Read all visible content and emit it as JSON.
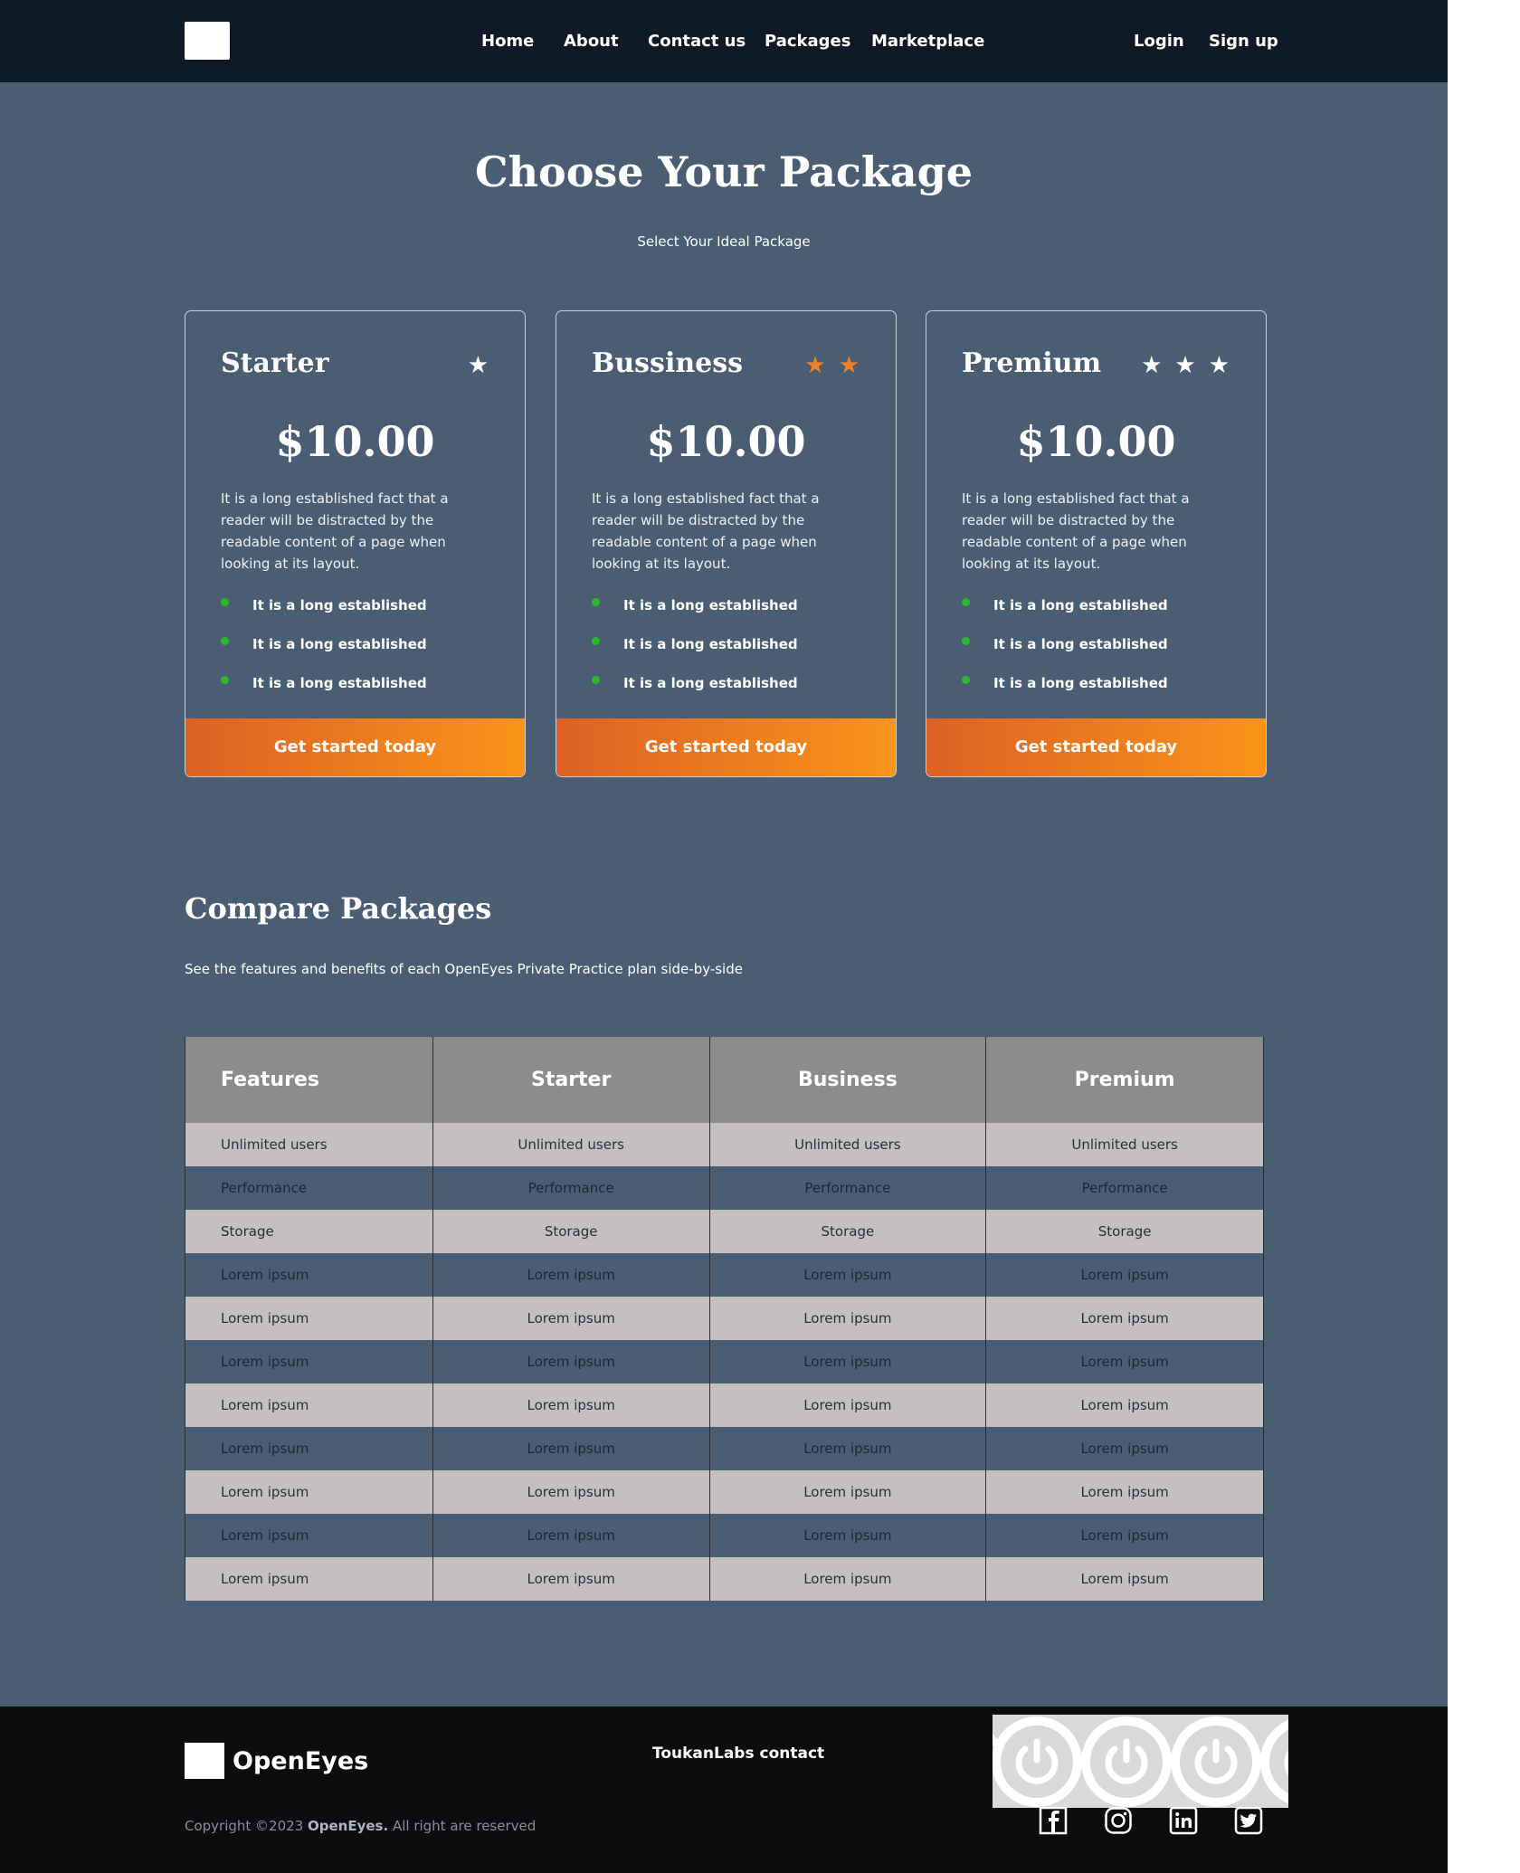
{
  "nav": {
    "links": [
      "Home",
      "About",
      "Contact us",
      "Packages",
      "Marketplace"
    ],
    "login": "Login",
    "signup": "Sign up"
  },
  "hero": {
    "title": "Choose Your Package",
    "subtitle": "Select Your Ideal Package"
  },
  "packages": [
    {
      "name": "Starter",
      "stars": 1,
      "star_color": "#ffffff",
      "price": "$10.00",
      "description": "It is a long established fact that a reader will be distracted by the readable content of a page when looking at its layout.",
      "features": [
        "It is a long established",
        "It is a long established",
        "It is a long established"
      ],
      "cta": "Get started today"
    },
    {
      "name": "Bussiness",
      "stars": 2,
      "star_color": "#f0812a",
      "price": "$10.00",
      "description": "It is a long established fact that a reader will be distracted by the readable content of a page when looking at its layout.",
      "features": [
        "It is a long established",
        "It is a long established",
        "It is a long established"
      ],
      "cta": "Get started today"
    },
    {
      "name": "Premium",
      "stars": 3,
      "star_color": "#ffffff",
      "price": "$10.00",
      "description": "It is a long established fact that a reader will be distracted by the readable content of a page when looking at its layout.",
      "features": [
        "It is a long established",
        "It is a long established",
        "It is a long established"
      ],
      "cta": "Get started today"
    }
  ],
  "compare": {
    "title": "Compare Packages",
    "subtitle": "See the features and benefits of each OpenEyes Private Practice plan side-by-side",
    "headers": [
      "Features",
      "Starter",
      "Business",
      "Premium"
    ],
    "rows": [
      [
        "Unlimited users",
        "Unlimited users",
        "Unlimited users",
        "Unlimited users"
      ],
      [
        "Performance",
        "Performance",
        "Performance",
        "Performance"
      ],
      [
        "Storage",
        "Storage",
        "Storage",
        "Storage"
      ],
      [
        "Lorem ipsum",
        "Lorem ipsum",
        "Lorem ipsum",
        "Lorem ipsum"
      ],
      [
        "Lorem ipsum",
        "Lorem ipsum",
        "Lorem ipsum",
        "Lorem ipsum"
      ],
      [
        "Lorem ipsum",
        "Lorem ipsum",
        "Lorem ipsum",
        "Lorem ipsum"
      ],
      [
        "Lorem ipsum",
        "Lorem ipsum",
        "Lorem ipsum",
        "Lorem ipsum"
      ],
      [
        "Lorem ipsum",
        "Lorem ipsum",
        "Lorem ipsum",
        "Lorem ipsum"
      ],
      [
        "Lorem ipsum",
        "Lorem ipsum",
        "Lorem ipsum",
        "Lorem ipsum"
      ],
      [
        "Lorem ipsum",
        "Lorem ipsum",
        "Lorem ipsum",
        "Lorem ipsum"
      ],
      [
        "Lorem ipsum",
        "Lorem ipsum",
        "Lorem ipsum",
        "Lorem ipsum"
      ]
    ]
  },
  "footer": {
    "brand": "OpenEyes",
    "copyright_prefix": "Copyright ©2023 ",
    "copyright_brand": "OpenEyes.",
    "copyright_suffix": " All right are reserved",
    "contact": "ToukanLabs contact",
    "socials": [
      "facebook-icon",
      "instagram-icon",
      "linkedin-icon",
      "twitter-icon"
    ]
  },
  "colors": {
    "page_bg": "#4b5d73",
    "nav_bg": "#0f1a27",
    "footer_bg": "#0c0d0f",
    "cta_start": "#dd6125",
    "cta_end": "#fa9418",
    "bullet": "#2db72d",
    "table_header": "#8c8c8c",
    "table_light_row": "#c4c0bf"
  }
}
